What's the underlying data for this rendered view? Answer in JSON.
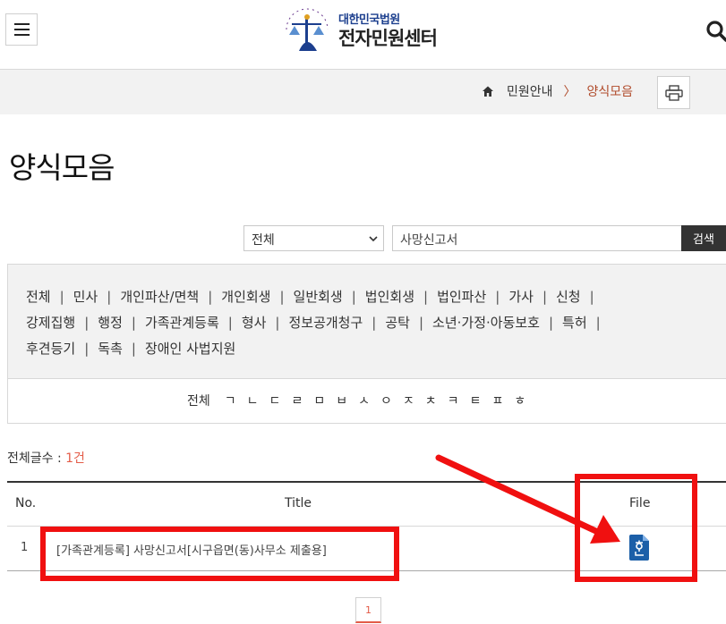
{
  "header": {
    "logo_sub": "대한민국법원",
    "logo_main": "전자민원센터"
  },
  "breadcrumb": {
    "parent": "민원안내",
    "separator": "〉",
    "current": "양식모음"
  },
  "page_title": "양식모음",
  "search": {
    "select_value": "전체",
    "input_value": "사망신고서",
    "button_label": "검색"
  },
  "categories": [
    "전체",
    "민사",
    "개인파산/면책",
    "개인회생",
    "일반회생",
    "법인회생",
    "법인파산",
    "가사",
    "신청",
    "강제집행",
    "행정",
    "가족관계등록",
    "형사",
    "정보공개청구",
    "공탁",
    "소년·가정·아동보호",
    "특허",
    "후견등기",
    "독촉",
    "장애인 사법지원"
  ],
  "index_letters": [
    "전체",
    "ㄱ",
    "ㄴ",
    "ㄷ",
    "ㄹ",
    "ㅁ",
    "ㅂ",
    "ㅅ",
    "ㅇ",
    "ㅈ",
    "ㅊ",
    "ㅋ",
    "ㅌ",
    "ㅍ",
    "ㅎ"
  ],
  "total": {
    "label": "전체글수 : ",
    "count": "1건"
  },
  "table": {
    "headers": {
      "no": "No.",
      "title": "Title",
      "file": "File"
    },
    "rows": [
      {
        "no": "1",
        "title": "[가족관계등록] 사망신고서[시구읍면(동)사무소 제출용]",
        "file_icon": "hwp-file-icon"
      }
    ]
  },
  "pagination": {
    "current": "1"
  },
  "colors": {
    "accent": "#e35c48",
    "breadcrumb": "#b04a2a",
    "annotation": "#f01010",
    "logo_blue": "#1c3f8e"
  }
}
